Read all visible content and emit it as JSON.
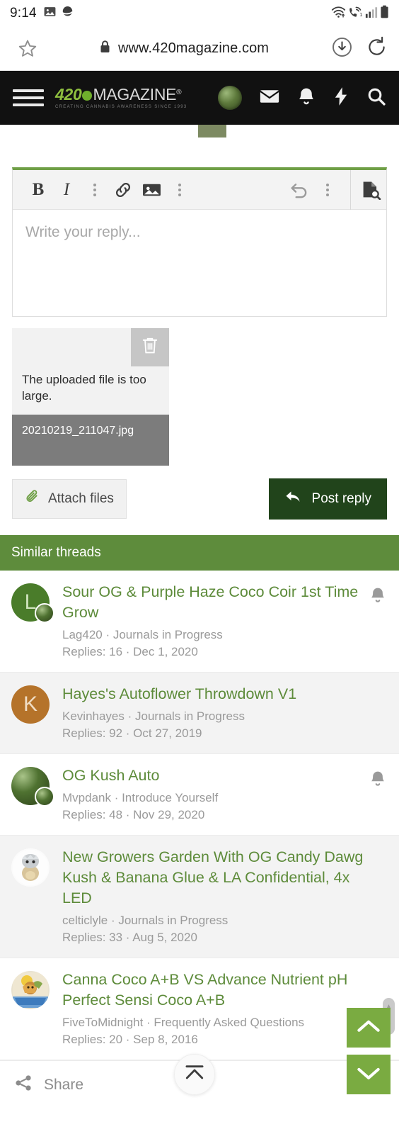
{
  "statusbar": {
    "clock": "9:14",
    "left_icons": [
      "image-icon",
      "app-icon"
    ],
    "right_icons": [
      "wifi-icon",
      "volte-call-icon",
      "signal-bars-icon",
      "battery-icon"
    ]
  },
  "browser": {
    "url": "www.420magazine.com",
    "lock_icon": "lock-icon",
    "star_icon": "star-icon",
    "download_icon": "download-icon",
    "reload_icon": "reload-icon"
  },
  "site_header": {
    "menu_icon": "hamburger-menu-icon",
    "logo_420": "420",
    "logo_magazine": "MAGAZINE",
    "logo_registered": "®",
    "logo_tagline": "CREATING CANNABIS AWARENESS SINCE 1993",
    "icons": [
      "user-avatar",
      "mail-icon",
      "bell-icon",
      "lightning-icon",
      "search-icon"
    ],
    "bg_color": "#111111",
    "accent_color": "#8ebe3f"
  },
  "editor": {
    "placeholder": "Write your reply...",
    "accent_color": "#6f9f46",
    "tools": [
      {
        "name": "bold-button",
        "label": "B"
      },
      {
        "name": "italic-button",
        "label": "I"
      },
      {
        "name": "text-more-button",
        "label": ""
      },
      {
        "name": "insert-link-button",
        "label": ""
      },
      {
        "name": "insert-image-button",
        "label": ""
      },
      {
        "name": "media-more-button",
        "label": ""
      }
    ],
    "right_tools": [
      {
        "name": "undo-button",
        "label": ""
      },
      {
        "name": "history-more-button",
        "label": ""
      },
      {
        "name": "preview-button",
        "label": ""
      }
    ]
  },
  "attachment": {
    "error_message": "The uploaded file is too large.",
    "filename": "20210219_211047.jpg",
    "delete_icon": "trash-icon"
  },
  "actions": {
    "attach_label": "Attach files",
    "attach_icon": "paperclip-icon",
    "post_label": "Post reply",
    "post_icon": "reply-arrow-icon",
    "post_color": "#21441b"
  },
  "similar_threads": {
    "header": "Similar threads",
    "header_color": "#5e8c3c",
    "link_color": "#5d8b3a",
    "threads": [
      {
        "title": "Sour OG & Purple Haze Coco Coir 1st Time Grow",
        "author": "Lag420",
        "forum": "Journals in Progress",
        "meta": "Lag420 · Journals in Progress",
        "replies_label": "Replies: 16 · Dec 1, 2020",
        "replies": 16,
        "date": "Dec 1, 2020",
        "avatar_kind": "letter",
        "avatar_letter": "L",
        "avatar_color": "#4a7c2a",
        "has_overlay": true,
        "has_bell": true
      },
      {
        "title": "Hayes's Autoflower Throwdown V1",
        "author": "Kevinhayes",
        "forum": "Journals in Progress",
        "meta": "Kevinhayes · Journals in Progress",
        "replies_label": "Replies: 92 · Oct 27, 2019",
        "replies": 92,
        "date": "Oct 27, 2019",
        "avatar_kind": "letter",
        "avatar_letter": "K",
        "avatar_color": "#b5732a",
        "has_overlay": false,
        "has_bell": false
      },
      {
        "title": "OG Kush Auto",
        "author": "Mvpdank",
        "forum": "Introduce Yourself",
        "meta": "Mvpdank · Introduce Yourself",
        "replies_label": "Replies: 48 · Nov 29, 2020",
        "replies": 48,
        "date": "Nov 29, 2020",
        "avatar_kind": "photo",
        "avatar_letter": "",
        "avatar_color": "#4f7231",
        "has_overlay": true,
        "has_bell": true
      },
      {
        "title": "New Growers Garden With OG Candy Dawg Kush & Banana Glue & LA Confidential, 4x LED",
        "author": "celticlyle",
        "forum": "Journals in Progress",
        "meta": "celticlyle · Journals in Progress",
        "replies_label": "Replies: 33 · Aug 5, 2020",
        "replies": 33,
        "date": "Aug 5, 2020",
        "avatar_kind": "cartoon",
        "avatar_letter": "",
        "avatar_color": "#fbfbfb",
        "has_overlay": false,
        "has_bell": false
      },
      {
        "title": "Canna Coco A+B VS Advance Nutrient pH Perfect Sensi Coco A+B",
        "author": "FiveToMidnight",
        "forum": "Frequently Asked Questions",
        "meta": "FiveToMidnight · Frequently Asked Questions",
        "replies_label": "Replies: 20 · Sep 8, 2016",
        "replies": 20,
        "date": "Sep 8, 2016",
        "avatar_kind": "cartoon2",
        "avatar_letter": "",
        "avatar_color": "#e9e2cf",
        "has_overlay": false,
        "has_bell": false
      }
    ]
  },
  "footer": {
    "share_label": "Share",
    "share_icon": "share-icon"
  },
  "floating": {
    "scroll_top_icon": "scroll-to-top-icon",
    "nav_up_icon": "chevron-up-icon",
    "nav_down_icon": "chevron-down-icon",
    "nav_color": "#7aab41"
  }
}
